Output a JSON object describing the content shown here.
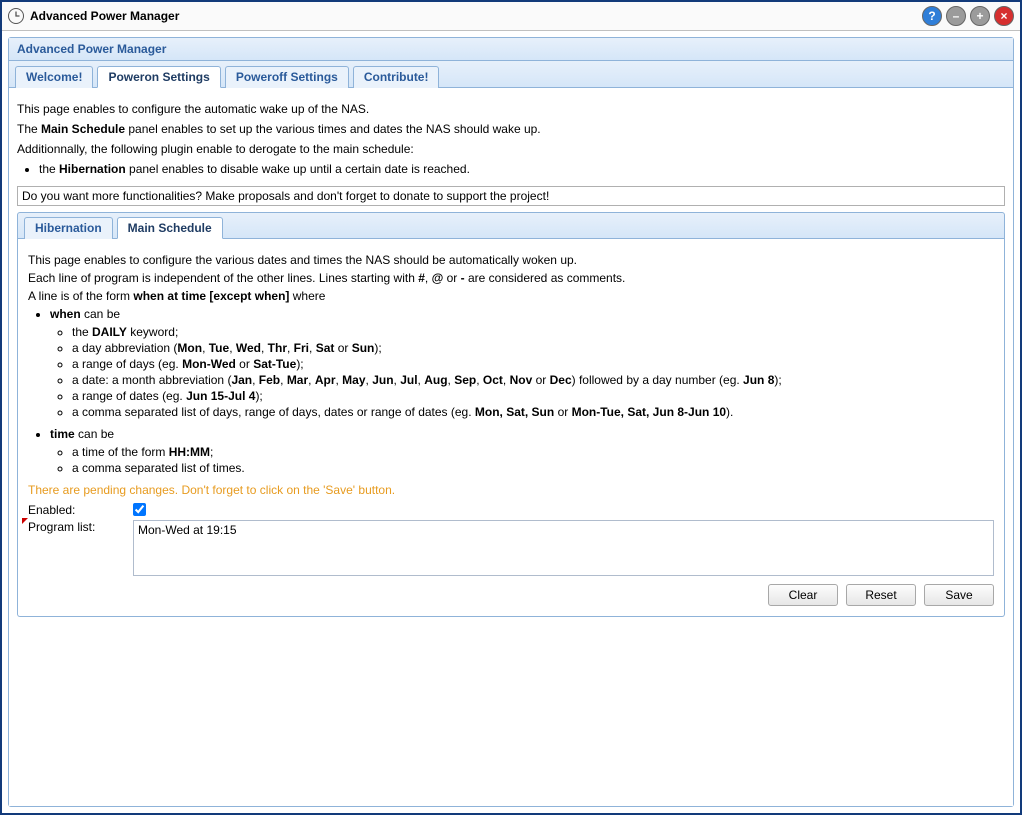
{
  "window": {
    "title": "Advanced Power Manager"
  },
  "panel": {
    "title": "Advanced Power Manager"
  },
  "tabs": {
    "welcome": "Welcome!",
    "poweron": "Poweron Settings",
    "poweroff": "Poweroff Settings",
    "contribute": "Contribute!"
  },
  "intro": {
    "p1": "This page enables to configure the automatic wake up of the NAS.",
    "p2_pre": "The ",
    "p2_b": "Main Schedule",
    "p2_post": " panel enables to set up the various times and dates the NAS should wake up.",
    "p3": "Additionnally, the following plugin enable to derogate to the main schedule:",
    "li_pre": "the ",
    "li_b": "Hibernation",
    "li_post": " panel enables to disable wake up until a certain date is reached."
  },
  "funcbox": "Do you want more functionalities? Make proposals and don't forget to donate to support the project!",
  "subtabs": {
    "hibernation": "Hibernation",
    "main": "Main Schedule"
  },
  "help": {
    "p1": "This page enables to configure the various dates and times the NAS should be automatically woken up.",
    "p2_a": "Each line of program is independent of the other lines. Lines starting with ",
    "hash": "#",
    "at": "@",
    "dash": "-",
    "p2_b": " are considered as comments.",
    "p3_a": "A line is of the form ",
    "p3_form": "when at time [except when]",
    "p3_b": " where",
    "when_b": "when",
    "when_txt": " can be",
    "daily_a": "the ",
    "daily_b": "DAILY",
    "daily_c": " keyword;",
    "abbr_a": "a day abbreviation (",
    "abbr_list": "Mon, Tue, Wed, Thr, Fri, Sat",
    "abbr_or": " or ",
    "abbr_sun": "Sun",
    "abbr_end": ");",
    "range_a": "a range of days (eg. ",
    "range_b": "Mon-Wed",
    "range_or": " or ",
    "range_c": "Sat-Tue",
    "range_end": ");",
    "date_a": "a date: a month abbreviation (",
    "date_list": "Jan, Feb, Mar, Apr, May, Jun, Jul, Aug, Sep, Oct, Nov",
    "date_or": " or ",
    "date_dec": "Dec",
    "date_b": ") followed by a day number (eg. ",
    "date_ex": "Jun 8",
    "date_end": ");",
    "drange_a": "a range of dates (eg. ",
    "drange_b": "Jun 15-Jul 4",
    "drange_end": ");",
    "csv_a": "a comma separated list of days, range of days, dates or range of dates (eg. ",
    "csv_b": "Mon, Sat, Sun",
    "csv_or": " or ",
    "csv_c": "Mon-Tue, Sat, Jun 8-Jun 10",
    "csv_end": ").",
    "time_b": "time",
    "time_txt": " can be",
    "tform_a": "a time of the form ",
    "tform_b": "HH:MM",
    "tform_end": ";",
    "tcsv": "a comma separated list of times."
  },
  "pending": "There are pending changes. Don't forget to click on the 'Save' button.",
  "form": {
    "enabled_label": "Enabled:",
    "enabled_value": true,
    "program_label": "Program list:",
    "program_value": "Mon-Wed at 19:15"
  },
  "buttons": {
    "clear": "Clear",
    "reset": "Reset",
    "save": "Save"
  }
}
